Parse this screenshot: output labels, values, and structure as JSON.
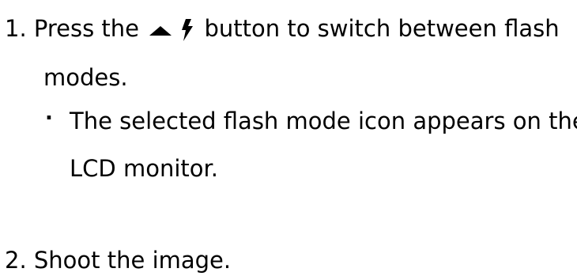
{
  "steps": [
    {
      "number": "1.",
      "text_before": "Press the",
      "icons": [
        "up-triangle-icon",
        "flash-bolt-icon"
      ],
      "text_after": "button to switch between flash",
      "text_line2": "modes.",
      "sub_bullet": {
        "bullet": ".",
        "line1": "The selected flash mode icon appears on the",
        "line2": "LCD monitor."
      }
    },
    {
      "number": "2.",
      "text": "Shoot the image."
    }
  ]
}
